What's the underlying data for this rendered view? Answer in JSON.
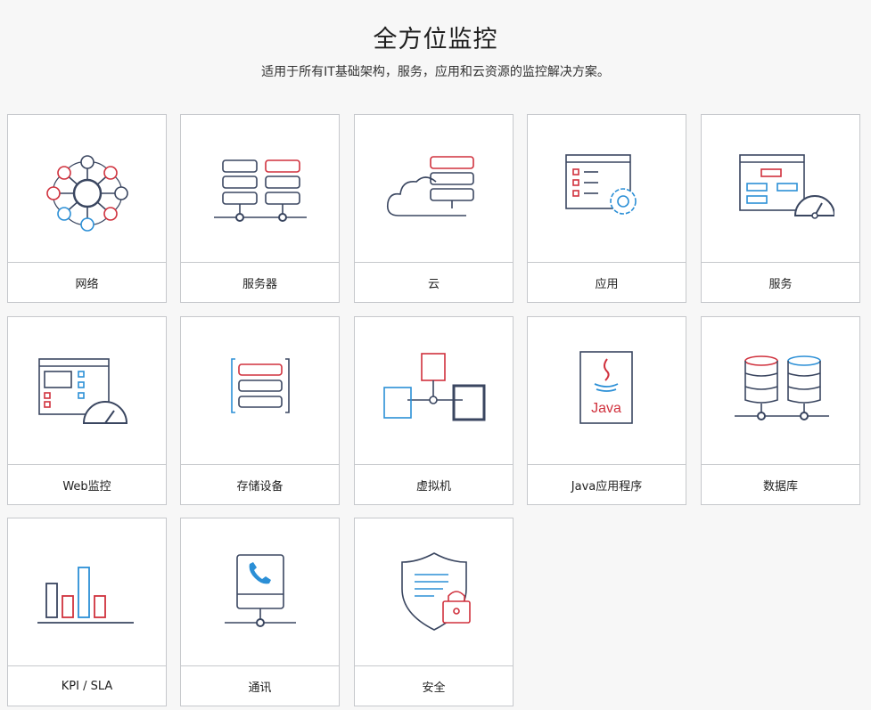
{
  "header": {
    "title": "全方位监控",
    "subtitle": "适用于所有IT基础架构，服务，应用和云资源的监控解决方案。"
  },
  "colors": {
    "navy": "#3a4660",
    "red": "#d0313d",
    "blue": "#2b8fd6"
  },
  "cards": [
    {
      "label": "网络",
      "icon": "network-icon"
    },
    {
      "label": "服务器",
      "icon": "server-icon"
    },
    {
      "label": "云",
      "icon": "cloud-icon"
    },
    {
      "label": "应用",
      "icon": "application-icon"
    },
    {
      "label": "服务",
      "icon": "service-icon"
    },
    {
      "label": "Web监控",
      "icon": "web-monitoring-icon"
    },
    {
      "label": "存储设备",
      "icon": "storage-icon"
    },
    {
      "label": "虚拟机",
      "icon": "virtual-machine-icon"
    },
    {
      "label": "Java应用程序",
      "icon": "java-icon"
    },
    {
      "label": "数据库",
      "icon": "database-icon"
    },
    {
      "label": "KPI / SLA",
      "icon": "kpi-sla-icon"
    },
    {
      "label": "通讯",
      "icon": "communication-icon"
    },
    {
      "label": "安全",
      "icon": "security-icon"
    }
  ],
  "java_logo_text": "Java"
}
